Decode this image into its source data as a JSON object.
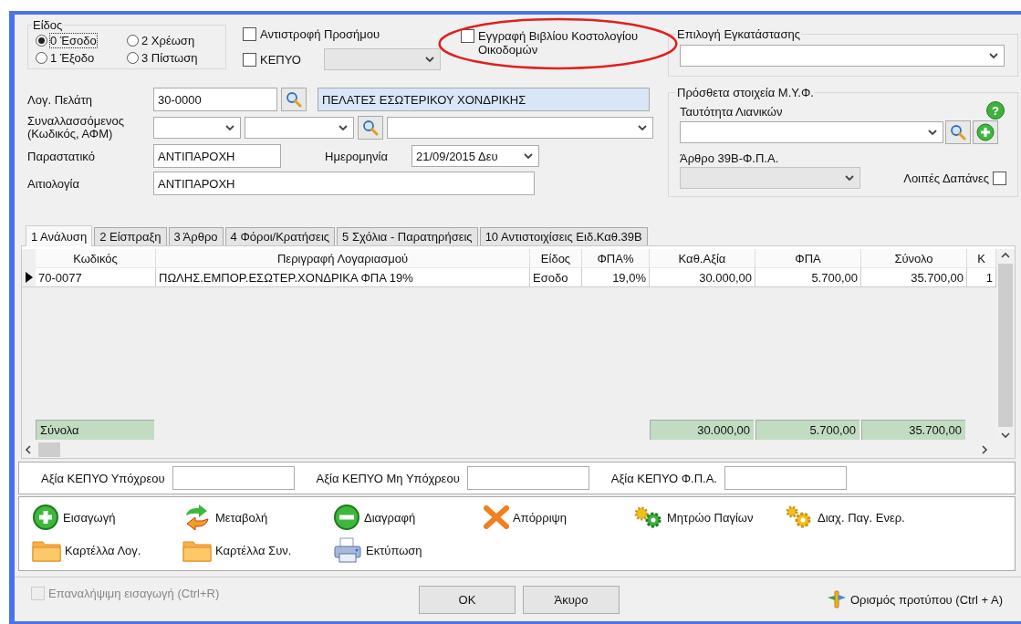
{
  "type_group": {
    "label": "Είδος",
    "options": [
      {
        "label": "0 Έσοδο",
        "selected": true
      },
      {
        "label": "2 Χρέωση",
        "selected": false
      },
      {
        "label": "1 Έξοδο",
        "selected": false
      },
      {
        "label": "3 Πίστωση",
        "selected": false
      }
    ]
  },
  "reverse_sign": {
    "label": "Αντιστροφή Προσήμου",
    "checked": false
  },
  "kepyo": {
    "label": "ΚΕΠΥΟ",
    "checked": false,
    "select_disabled": true
  },
  "cost_book": {
    "label": "Εγγραφή Βιβλίου Κοστολογίου Οικοδομών",
    "checked": false
  },
  "customer_account": {
    "label": "Λογ. Πελάτη",
    "value": "30-0000",
    "name": "ΠΕΛΑΤΕΣ ΕΣΩΤΕΡΙΚΟΥ ΧΟΝΔΡΙΚΗΣ"
  },
  "counterparty": {
    "label": "Συναλλασσόμενος (Κωδικός, ΑΦΜ)"
  },
  "document": {
    "label": "Παραστατικό",
    "value": "ΑΝΤΙΠΑΡΟΧΗ"
  },
  "date": {
    "label": "Ημερομηνία",
    "value": "21/09/2015 Δευ"
  },
  "reason": {
    "label": "Αιτιολογία",
    "value": "ΑΝΤΙΠΑΡΟΧΗ"
  },
  "installation": {
    "title": "Επιλογή Εγκατάστασης"
  },
  "myf": {
    "title": "Πρόσθετα στοιχεία Μ.Υ.Φ.",
    "help": "?",
    "retail_id_label": "Ταυτότητα Λιανικών",
    "article_label": "Άρθρο 39Β-Φ.Π.Α.",
    "article_disabled": true,
    "other_expenses": {
      "label": "Λοιπές Δαπάνες",
      "checked": false
    }
  },
  "tabs": [
    {
      "label": "1 Ανάλυση",
      "selected": true
    },
    {
      "label": "2 Είσπραξη",
      "selected": false
    },
    {
      "label": "3 Άρθρο",
      "selected": false
    },
    {
      "label": "4 Φόροι/Κρατήσεις",
      "selected": false
    },
    {
      "label": "5 Σχόλια - Παρατηρήσεις",
      "selected": false
    },
    {
      "label": "10 Αντιστοιχίσεις Ειδ.Καθ.39Β",
      "selected": false
    }
  ],
  "table": {
    "columns": [
      "Κωδικός",
      "Περιγραφή Λογαριασμού",
      "Είδος",
      "ΦΠΑ%",
      "Καθ.Αξία",
      "ΦΠΑ",
      "Σύνολο",
      "Κ"
    ],
    "rows": [
      {
        "selected": true,
        "cells": [
          "70-0077",
          "ΠΩΛΗΣ.ΕΜΠΟΡ.ΕΣΩΤΕΡ.ΧΟΝΔΡΙΚΑ ΦΠΑ 19%",
          "Εσοδο",
          "19,0%",
          "30.000,00",
          "5.700,00",
          "35.700,00",
          "1"
        ]
      }
    ],
    "totals": {
      "label": "Σύνολα",
      "net": "30.000,00",
      "vat": "5.700,00",
      "total": "35.700,00"
    }
  },
  "kepyo_values": [
    {
      "label": "Αξία ΚΕΠΥΟ Υπόχρεου"
    },
    {
      "label": "Αξία ΚΕΠΥΟ Μη Υπόχρεου"
    },
    {
      "label": "Αξία ΚΕΠΥΟ Φ.Π.Α."
    }
  ],
  "actions": [
    {
      "label": "Εισαγωγή",
      "kind": "add"
    },
    {
      "label": "Μεταβολή",
      "kind": "edit"
    },
    {
      "label": "Διαγραφή",
      "kind": "delete"
    },
    {
      "label": "Απόρριψη",
      "kind": "reject"
    },
    {
      "label": "Μητρώο Παγίων",
      "kind": "gears-green"
    },
    {
      "label": "Διαχ. Παγ. Ενερ.",
      "kind": "gears"
    },
    {
      "label": "Καρτέλλα Λογ.",
      "kind": "folder"
    },
    {
      "label": "Καρτέλλα Συν.",
      "kind": "folder"
    },
    {
      "label": "Εκτύπωση",
      "kind": "print"
    }
  ],
  "repeat_entry": {
    "label": "Επαναλήψιμη εισαγωγή (Ctrl+R)",
    "checked": false,
    "disabled": true
  },
  "buttons": [
    "OK",
    "Άκυρο"
  ],
  "template_link": "Ορισμός προτύπου (Ctrl + A)"
}
